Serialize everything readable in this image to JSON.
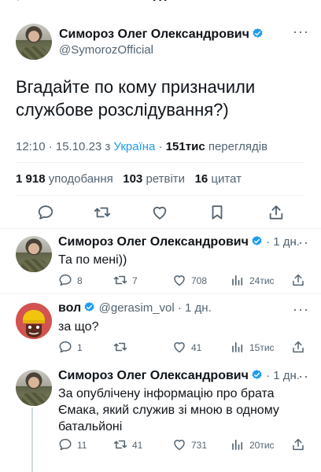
{
  "header": {
    "back_glyph": "<",
    "title": "Пт"
  },
  "main_tweet": {
    "author": "Симороз Олег Олександрович",
    "handle": "@SymorozOfficial",
    "text": "Вгадайте по кому призначили службове розслідування?)",
    "time": "12:10 · 15.10.23 з ",
    "location": "Україна",
    "views_sep": " · ",
    "views_count": "151тис",
    "views_label": " переглядів",
    "likes_count": "1 918",
    "likes_label": " уподобання",
    "retweets_count": "103",
    "retweets_label": " ретвіти",
    "quotes_count": "16",
    "quotes_label": " цитат"
  },
  "replies": [
    {
      "author": "Симороз Олег Олександрович",
      "when": " · 1 дн.",
      "text": "Та по мені))",
      "replies": "8",
      "retweets": "7",
      "likes": "708",
      "views": "24тис"
    },
    {
      "author": "вол",
      "handle": "@gerasim_vol",
      "when": " · 1 дн.",
      "text": "за що?",
      "replies": "1",
      "retweets": "",
      "likes": "41",
      "views": "15тис"
    },
    {
      "author": "Симороз Олег Олександрович",
      "when": " · 1 дн.",
      "text": "За опублічену інформацію про брата Ємака, який служив зі мною в одному батальйоні",
      "replies": "11",
      "retweets": "41",
      "likes": "731",
      "views": "20тис"
    }
  ],
  "colors": {
    "accent": "#1d9bf0",
    "muted": "#536471",
    "text": "#0f1419"
  },
  "icons": [
    "back-icon",
    "verified-icon",
    "more-icon",
    "reply-icon",
    "retweet-icon",
    "like-icon",
    "bookmark-icon",
    "share-icon",
    "views-icon"
  ]
}
